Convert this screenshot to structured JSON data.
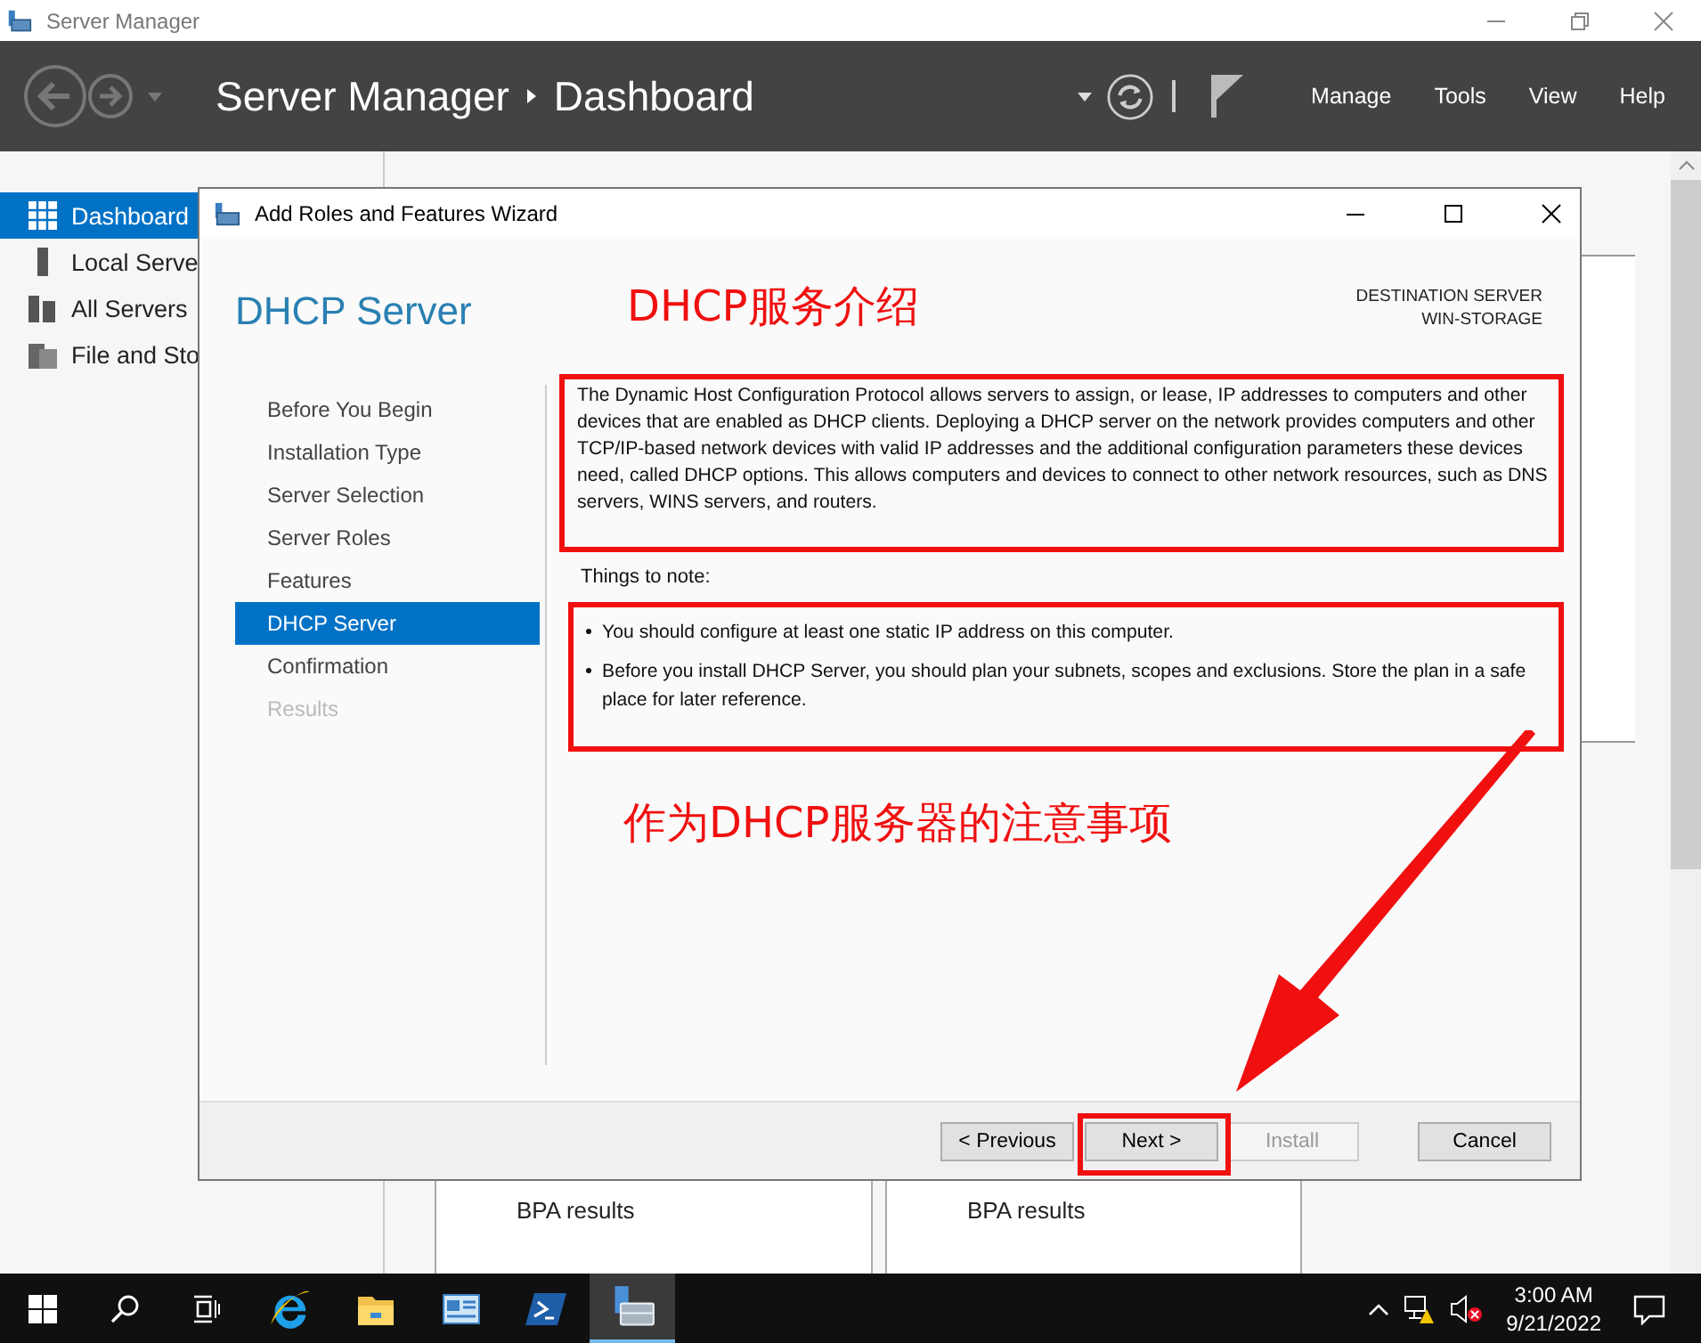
{
  "window": {
    "title": "Server Manager"
  },
  "header": {
    "breadcrumb": [
      "Server Manager",
      "Dashboard"
    ],
    "menu": [
      "Manage",
      "Tools",
      "View",
      "Help"
    ]
  },
  "sidebar": {
    "items": [
      {
        "label": "Dashboard",
        "kind": "grid",
        "selected": true
      },
      {
        "label": "Local Serve",
        "kind": "server",
        "selected": false
      },
      {
        "label": "All Servers",
        "kind": "servers",
        "selected": false
      },
      {
        "label": "File and Sto",
        "kind": "files",
        "selected": false
      }
    ]
  },
  "tiles": [
    {
      "label": "BPA results"
    },
    {
      "label": "BPA results"
    }
  ],
  "wizard": {
    "title": "Add Roles and Features Wizard",
    "heading": "DHCP Server",
    "destination": [
      "DESTINATION SERVER",
      "WIN-STORAGE"
    ],
    "steps": [
      {
        "label": "Before You Begin",
        "selected": false,
        "disabled": false
      },
      {
        "label": "Installation Type",
        "selected": false,
        "disabled": false
      },
      {
        "label": "Server Selection",
        "selected": false,
        "disabled": false
      },
      {
        "label": "Server Roles",
        "selected": false,
        "disabled": false
      },
      {
        "label": "Features",
        "selected": false,
        "disabled": false
      },
      {
        "label": "DHCP Server",
        "selected": true,
        "disabled": false
      },
      {
        "label": "Confirmation",
        "selected": false,
        "disabled": false
      },
      {
        "label": "Results",
        "selected": false,
        "disabled": true
      }
    ],
    "description": "The Dynamic Host Configuration Protocol allows servers to assign, or lease, IP addresses to computers and other devices that are enabled as DHCP clients. Deploying a DHCP server on the network provides computers and other TCP/IP-based network devices with valid IP addresses and the additional configuration parameters these devices need, called DHCP options. This allows computers and devices to connect to other network resources, such as DNS servers, WINS servers, and routers.",
    "notes_heading": "Things to note:",
    "notes": [
      "You should configure at least one static IP address on this computer.",
      "Before you install DHCP Server, you should plan your subnets, scopes and exclusions. Store the plan in a safe place for later reference."
    ],
    "buttons": [
      {
        "label": "< Previous",
        "disabled": false
      },
      {
        "label": "Next >",
        "disabled": false
      },
      {
        "label": "Install",
        "disabled": true
      },
      {
        "label": "Cancel",
        "disabled": false
      }
    ]
  },
  "annotations": [
    "DHCP服务介绍",
    "作为DHCP服务器的注意事项"
  ],
  "taskbar": {
    "apps": [
      {
        "kind": "ie",
        "selected": false
      },
      {
        "kind": "folder",
        "selected": false
      },
      {
        "kind": "panel",
        "selected": false
      },
      {
        "kind": "shell",
        "selected": false
      },
      {
        "kind": "server",
        "selected": true
      }
    ],
    "time": "3:00 AM",
    "date": "9/21/2022"
  }
}
